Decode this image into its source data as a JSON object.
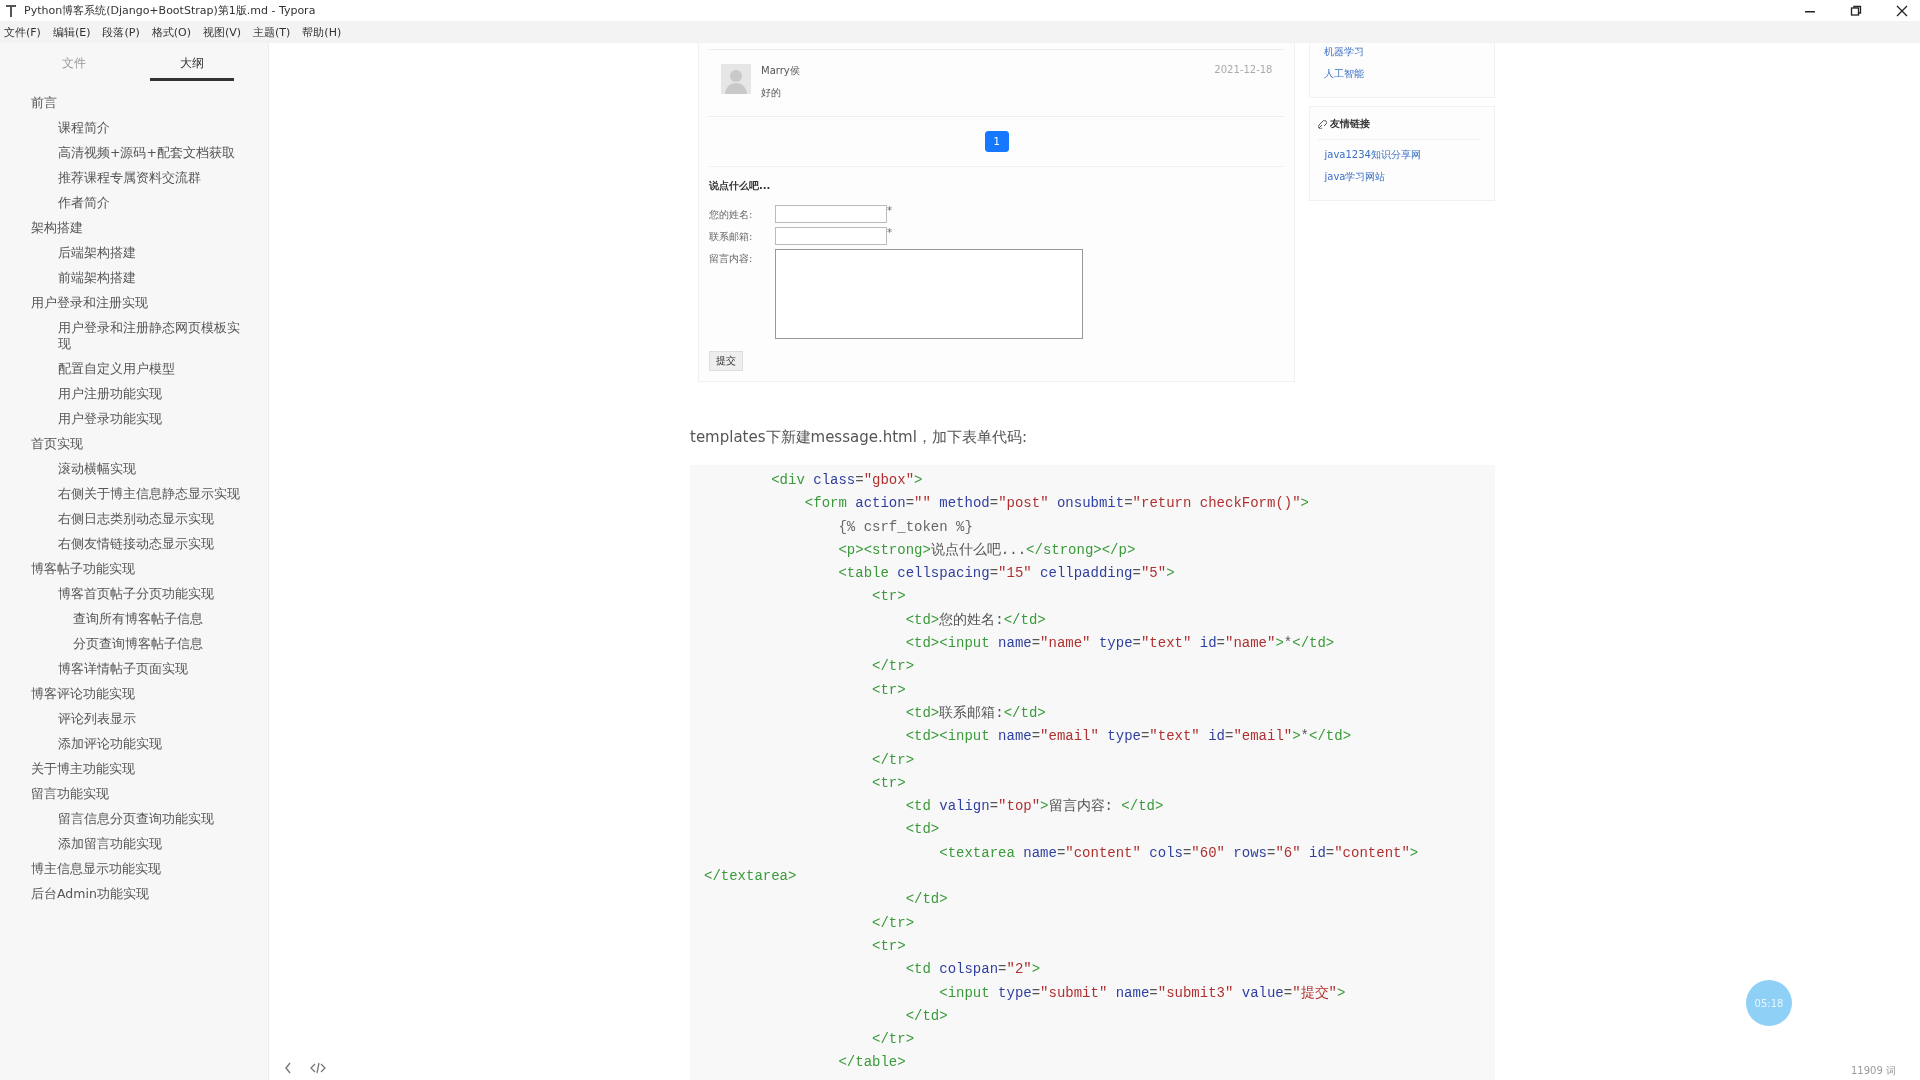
{
  "window": {
    "title": "Python博客系统(Django+BootStrap)第1版.md - Typora",
    "menu": [
      "文件(F)",
      "编辑(E)",
      "段落(P)",
      "格式(O)",
      "视图(V)",
      "主题(T)",
      "帮助(H)"
    ]
  },
  "sidebar": {
    "tabs": [
      {
        "label": "文件",
        "selected": false
      },
      {
        "label": "大纲",
        "selected": true
      }
    ],
    "outline": [
      {
        "label": "前言",
        "children": [
          {
            "label": "课程简介"
          },
          {
            "label": "高清视频+源码+配套文档获取"
          },
          {
            "label": "推荐课程专属资料交流群"
          },
          {
            "label": "作者简介"
          }
        ]
      },
      {
        "label": "架构搭建",
        "children": [
          {
            "label": "后端架构搭建"
          },
          {
            "label": "前端架构搭建"
          }
        ]
      },
      {
        "label": "用户登录和注册实现",
        "children": [
          {
            "label": "用户登录和注册静态网页模板实现"
          },
          {
            "label": "配置自定义用户模型"
          },
          {
            "label": "用户注册功能实现"
          },
          {
            "label": "用户登录功能实现"
          }
        ]
      },
      {
        "label": "首页实现",
        "children": [
          {
            "label": "滚动横幅实现"
          },
          {
            "label": "右侧关于博主信息静态显示实现"
          },
          {
            "label": "右侧日志类别动态显示实现"
          },
          {
            "label": "右侧友情链接动态显示实现"
          }
        ]
      },
      {
        "label": "博客帖子功能实现",
        "children": [
          {
            "label": "博客首页帖子分页功能实现",
            "children": [
              {
                "label": "查询所有博客帖子信息"
              },
              {
                "label": "分页查询博客帖子信息"
              }
            ]
          },
          {
            "label": "博客详情帖子页面实现"
          }
        ]
      },
      {
        "label": "博客评论功能实现",
        "children": [
          {
            "label": "评论列表显示"
          },
          {
            "label": "添加评论功能实现"
          }
        ]
      },
      {
        "label": "关于博主功能实现"
      },
      {
        "label": "留言功能实现",
        "children": [
          {
            "label": "留言信息分页查询功能实现"
          },
          {
            "label": "添加留言功能实现"
          }
        ]
      },
      {
        "label": "博主信息显示功能实现"
      },
      {
        "label": "后台Admin功能实现"
      }
    ]
  },
  "embedded_screenshot": {
    "comment": {
      "author": "Marry侯",
      "text": "好的",
      "date": "2021-12-18"
    },
    "pagination": [
      {
        "label": "1",
        "selected": true
      }
    ],
    "form": {
      "heading": "说点什么吧...",
      "fields": [
        {
          "label": "您的姓名:",
          "kind": "input",
          "mark": "*"
        },
        {
          "label": "联系邮箱:",
          "kind": "input",
          "mark": "*"
        },
        {
          "label": "留言内容:",
          "kind": "textarea"
        }
      ],
      "button": "提交"
    },
    "side_panels": [
      {
        "links": [
          "机器学习",
          "人工智能"
        ]
      },
      {
        "title": "友情链接",
        "links": [
          "java1234知识分享网",
          "java学习网站"
        ]
      }
    ]
  },
  "paragraph": "templates下新建message.html，加下表单代码:",
  "code_lines": [
    "        <div class=\"gbox\">",
    "            <form action=\"\" method=\"post\" onsubmit=\"return checkForm()\">",
    "                {% csrf_token %}",
    "                <p><strong>说点什么吧...</strong></p>",
    "                <table cellspacing=\"15\" cellpadding=\"5\">",
    "                    <tr>",
    "                        <td>您的姓名:</td>",
    "                        <td><input name=\"name\" type=\"text\" id=\"name\">*</td>",
    "                    </tr>",
    "                    <tr>",
    "                        <td>联系邮箱:</td>",
    "                        <td><input name=\"email\" type=\"text\" id=\"email\">*</td>",
    "                    </tr>",
    "                    <tr>",
    "                        <td valign=\"top\">留言内容: </td>",
    "                        <td>",
    "                            <textarea name=\"content\" cols=\"60\" rows=\"6\" id=\"content\">",
    "</textarea>",
    "                        </td>",
    "                    </tr>",
    "                    <tr>",
    "                        <td colspan=\"2\">",
    "                            <input type=\"submit\" name=\"submit3\" value=\"提交\">",
    "                        </td>",
    "                    </tr>",
    "                </table>"
  ],
  "recorder_badge": "05:18",
  "word_count": "11909 词"
}
